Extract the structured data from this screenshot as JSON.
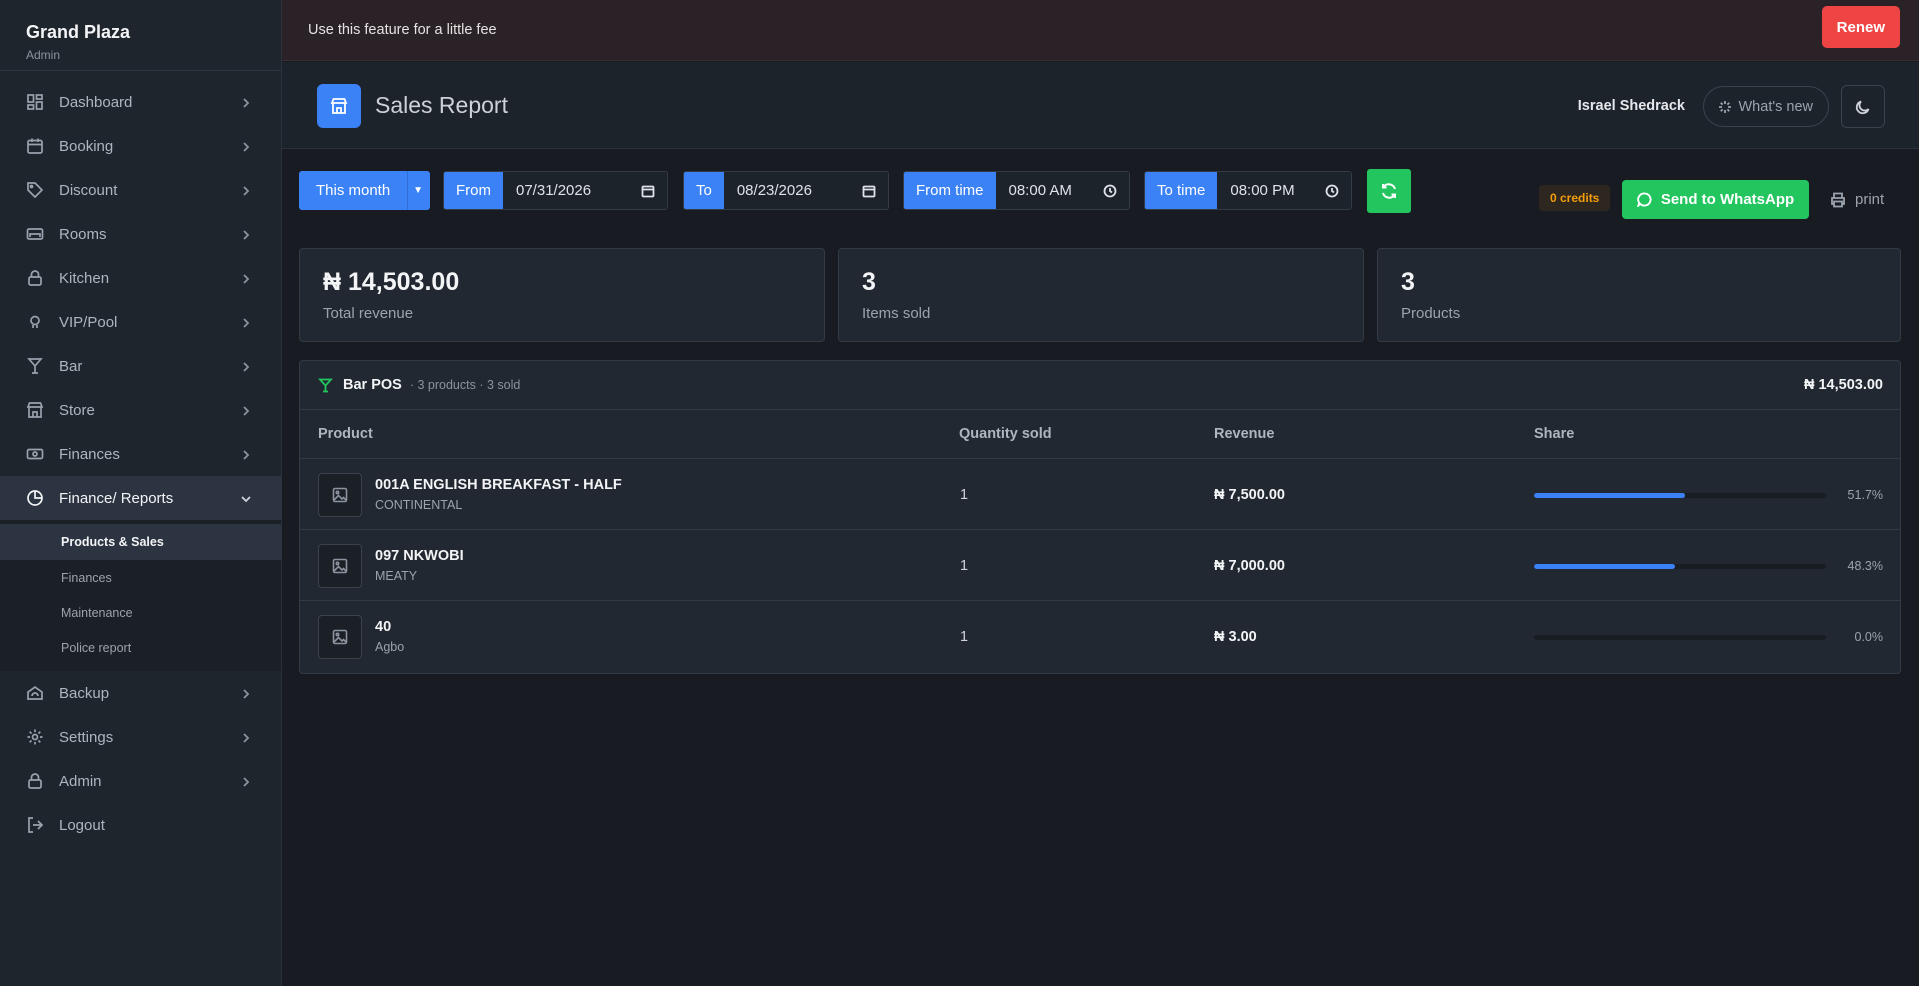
{
  "sidebar": {
    "brand": "Grand Plaza",
    "role": "Admin",
    "items": [
      {
        "label": "Dashboard",
        "icon": "dashboard-icon"
      },
      {
        "label": "Booking",
        "icon": "calendar-icon"
      },
      {
        "label": "Discount",
        "icon": "tag-icon"
      },
      {
        "label": "Rooms",
        "icon": "bed-icon"
      },
      {
        "label": "Kitchen",
        "icon": "lock-icon"
      },
      {
        "label": "VIP/Pool",
        "icon": "pool-icon"
      },
      {
        "label": "Bar",
        "icon": "cocktail-icon"
      },
      {
        "label": "Store",
        "icon": "store-icon"
      },
      {
        "label": "Finances",
        "icon": "cash-icon"
      },
      {
        "label": "Finance/ Reports",
        "icon": "pie-chart-icon"
      },
      {
        "label": "Backup",
        "icon": "cloud-icon"
      },
      {
        "label": "Settings",
        "icon": "gear-icon"
      },
      {
        "label": "Admin",
        "icon": "lock-icon"
      },
      {
        "label": "Logout",
        "icon": "logout-icon"
      }
    ],
    "subitems": [
      "Products & Sales",
      "Finances",
      "Maintenance",
      "Police report"
    ]
  },
  "banner": {
    "text": "Use this feature for a little fee",
    "button": "Renew"
  },
  "header": {
    "title": "Sales Report",
    "user": "Israel Shedrack",
    "whats_new": "What's new"
  },
  "filters": {
    "period": "This month",
    "from_label": "From",
    "from_value": "07/31/2026",
    "to_label": "To",
    "to_value": "08/23/2026",
    "from_time_label": "From time",
    "from_time_value": "08:00 AM",
    "to_time_label": "To time",
    "to_time_value": "08:00 PM",
    "credits": "0 credits",
    "whatsapp": "Send to WhatsApp",
    "print": "print"
  },
  "stats": [
    {
      "value": "₦ 14,503.00",
      "label": "Total revenue"
    },
    {
      "value": "3",
      "label": "Items sold"
    },
    {
      "value": "3",
      "label": "Products"
    }
  ],
  "table": {
    "title": "Bar POS",
    "meta": "· 3 products · 3 sold",
    "total": "₦ 14,503.00",
    "columns": [
      "Product",
      "Quantity sold",
      "Revenue",
      "Share"
    ],
    "rows": [
      {
        "name": "001A ENGLISH BREAKFAST - HALF",
        "category": "CONTINENTAL",
        "qty": "1",
        "revenue": "₦ 7,500.00",
        "share": "51.7%",
        "share_value": 51.7
      },
      {
        "name": "097 NKWOBI",
        "category": "MEATY",
        "qty": "1",
        "revenue": "₦ 7,000.00",
        "share": "48.3%",
        "share_value": 48.3
      },
      {
        "name": "40",
        "category": "Agbo",
        "qty": "1",
        "revenue": "₦ 3.00",
        "share": "0.0%",
        "share_value": 0
      }
    ]
  },
  "colors": {
    "accent": "#3b82f6",
    "success": "#22c55e",
    "danger": "#ef4444",
    "warning": "#f59e0b"
  }
}
